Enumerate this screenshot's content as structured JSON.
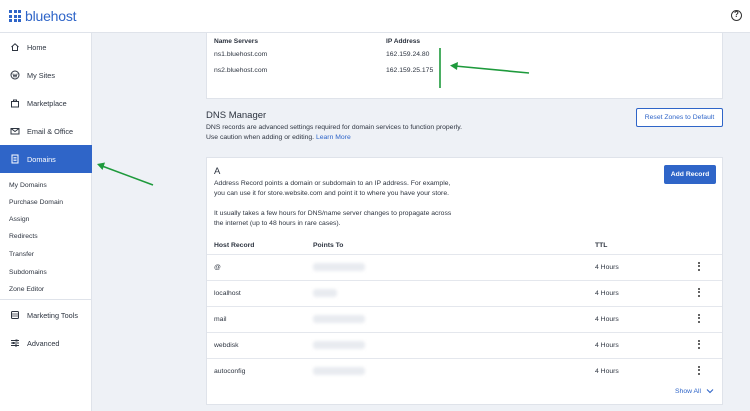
{
  "header": {
    "brand": "bluehost",
    "help_icon": "?"
  },
  "sidebar": {
    "items": [
      {
        "label": "Home",
        "icon": "home-icon"
      },
      {
        "label": "My Sites",
        "icon": "wordpress-icon"
      },
      {
        "label": "Marketplace",
        "icon": "bag-icon"
      },
      {
        "label": "Email & Office",
        "icon": "mail-icon"
      },
      {
        "label": "Domains",
        "icon": "domains-icon"
      }
    ],
    "sub_items": [
      "My Domains",
      "Purchase Domain",
      "Assign",
      "Redirects",
      "Transfer",
      "Subdomains",
      "Zone Editor"
    ],
    "bottom_items": [
      {
        "label": "Marketing Tools",
        "icon": "marketing-icon"
      },
      {
        "label": "Advanced",
        "icon": "sliders-icon"
      }
    ]
  },
  "nameservers": {
    "col_name": "Name Servers",
    "col_ip": "IP Address",
    "rows": [
      {
        "name": "ns1.bluehost.com",
        "ip": "162.159.24.80"
      },
      {
        "name": "ns2.bluehost.com",
        "ip": "162.159.25.175"
      }
    ]
  },
  "dns_manager": {
    "title": "DNS Manager",
    "description": "DNS records are advanced settings required for domain services to function properly. Use caution when adding or editing.",
    "learn_more": "Learn More",
    "reset_button": "Reset Zones to Default"
  },
  "a_records": {
    "title": "A",
    "desc1_line1": "Address Record points a domain or subdomain to an IP address. For example,",
    "desc1_line2": "you can use it for store.website.com and point it to where you have your store.",
    "desc2_line1": "It usually takes a few hours for DNS/name server changes to propagate across",
    "desc2_line2": "the internet (up to 48 hours in rare cases).",
    "add_button": "Add Record",
    "columns": {
      "host": "Host Record",
      "points": "Points To",
      "ttl": "TTL"
    },
    "rows": [
      {
        "host": "@",
        "ttl": "4 Hours"
      },
      {
        "host": "localhost",
        "ttl": "4 Hours"
      },
      {
        "host": "mail",
        "ttl": "4 Hours"
      },
      {
        "host": "webdisk",
        "ttl": "4 Hours"
      },
      {
        "host": "autoconfig",
        "ttl": "4 Hours"
      }
    ],
    "show_all": "Show All"
  },
  "colors": {
    "brand_blue": "#2f65c8",
    "annotation_green": "#1e9a3c"
  }
}
